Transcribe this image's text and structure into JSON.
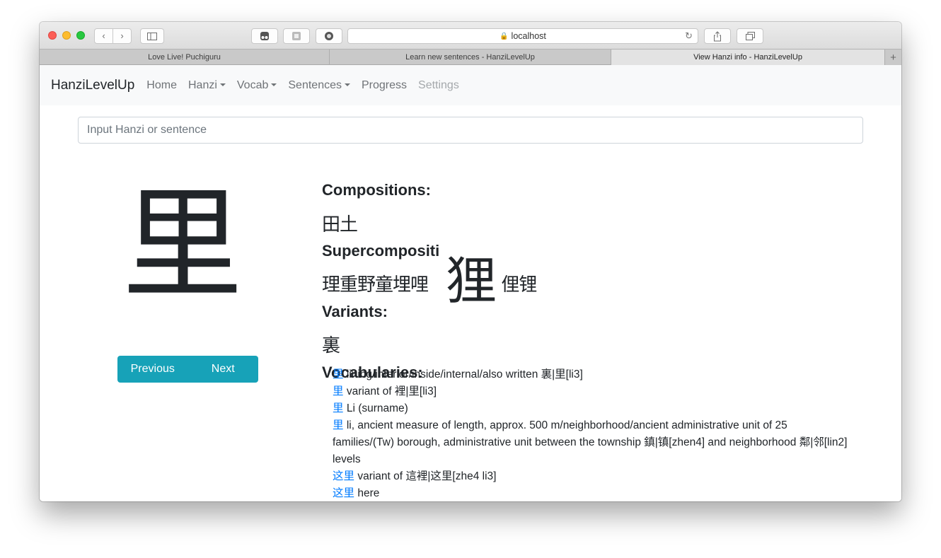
{
  "browser": {
    "url": "localhost",
    "tabs": [
      {
        "label": "Love Live! Puchiguru"
      },
      {
        "label": "Learn new sentences - HanziLevelUp"
      },
      {
        "label": "View Hanzi info - HanziLevelUp"
      }
    ],
    "new_tab_label": "+",
    "back_icon": "‹",
    "forward_icon": "›",
    "lock_icon": "🔒",
    "reload_icon": "↻"
  },
  "navbar": {
    "brand": "HanziLevelUp",
    "items": [
      {
        "label": "Home"
      },
      {
        "label": "Hanzi"
      },
      {
        "label": "Vocab"
      },
      {
        "label": "Sentences"
      },
      {
        "label": "Progress"
      },
      {
        "label": "Settings"
      }
    ]
  },
  "search": {
    "placeholder": "Input Hanzi or sentence"
  },
  "hanzi": {
    "character": "里",
    "hover_character": "狸",
    "previous_label": "Previous",
    "next_label": "Next"
  },
  "sections": {
    "compositions_title": "Compositions:",
    "compositions": "田土",
    "supercompositions_title": "Supercompositi",
    "supercompositions_left": "理重野童埋哩",
    "supercompositions_right": "!俚锂",
    "variants_title": "Variants:",
    "variants": "裏",
    "vocabularies_title": "Vocabularies:"
  },
  "vocabularies": [
    {
      "word": "里",
      "definition": " lining/interior/inside/internal/also written 裏|里[li3]"
    },
    {
      "word": "里",
      "definition": " variant of 裡|里[li3]"
    },
    {
      "word": "里",
      "definition": " Li (surname)"
    },
    {
      "word": "里",
      "definition": " li, ancient measure of length, approx. 500 m/neighborhood/ancient administrative unit of 25 families/(Tw) borough, administrative unit between the township 鎮|镇[zhen4] and neighborhood 鄰|邻[lin2] levels"
    },
    {
      "word": "这里",
      "definition": " variant of 這裡|这里[zhe4 li3]"
    },
    {
      "word": "这里",
      "definition": " here"
    }
  ]
}
